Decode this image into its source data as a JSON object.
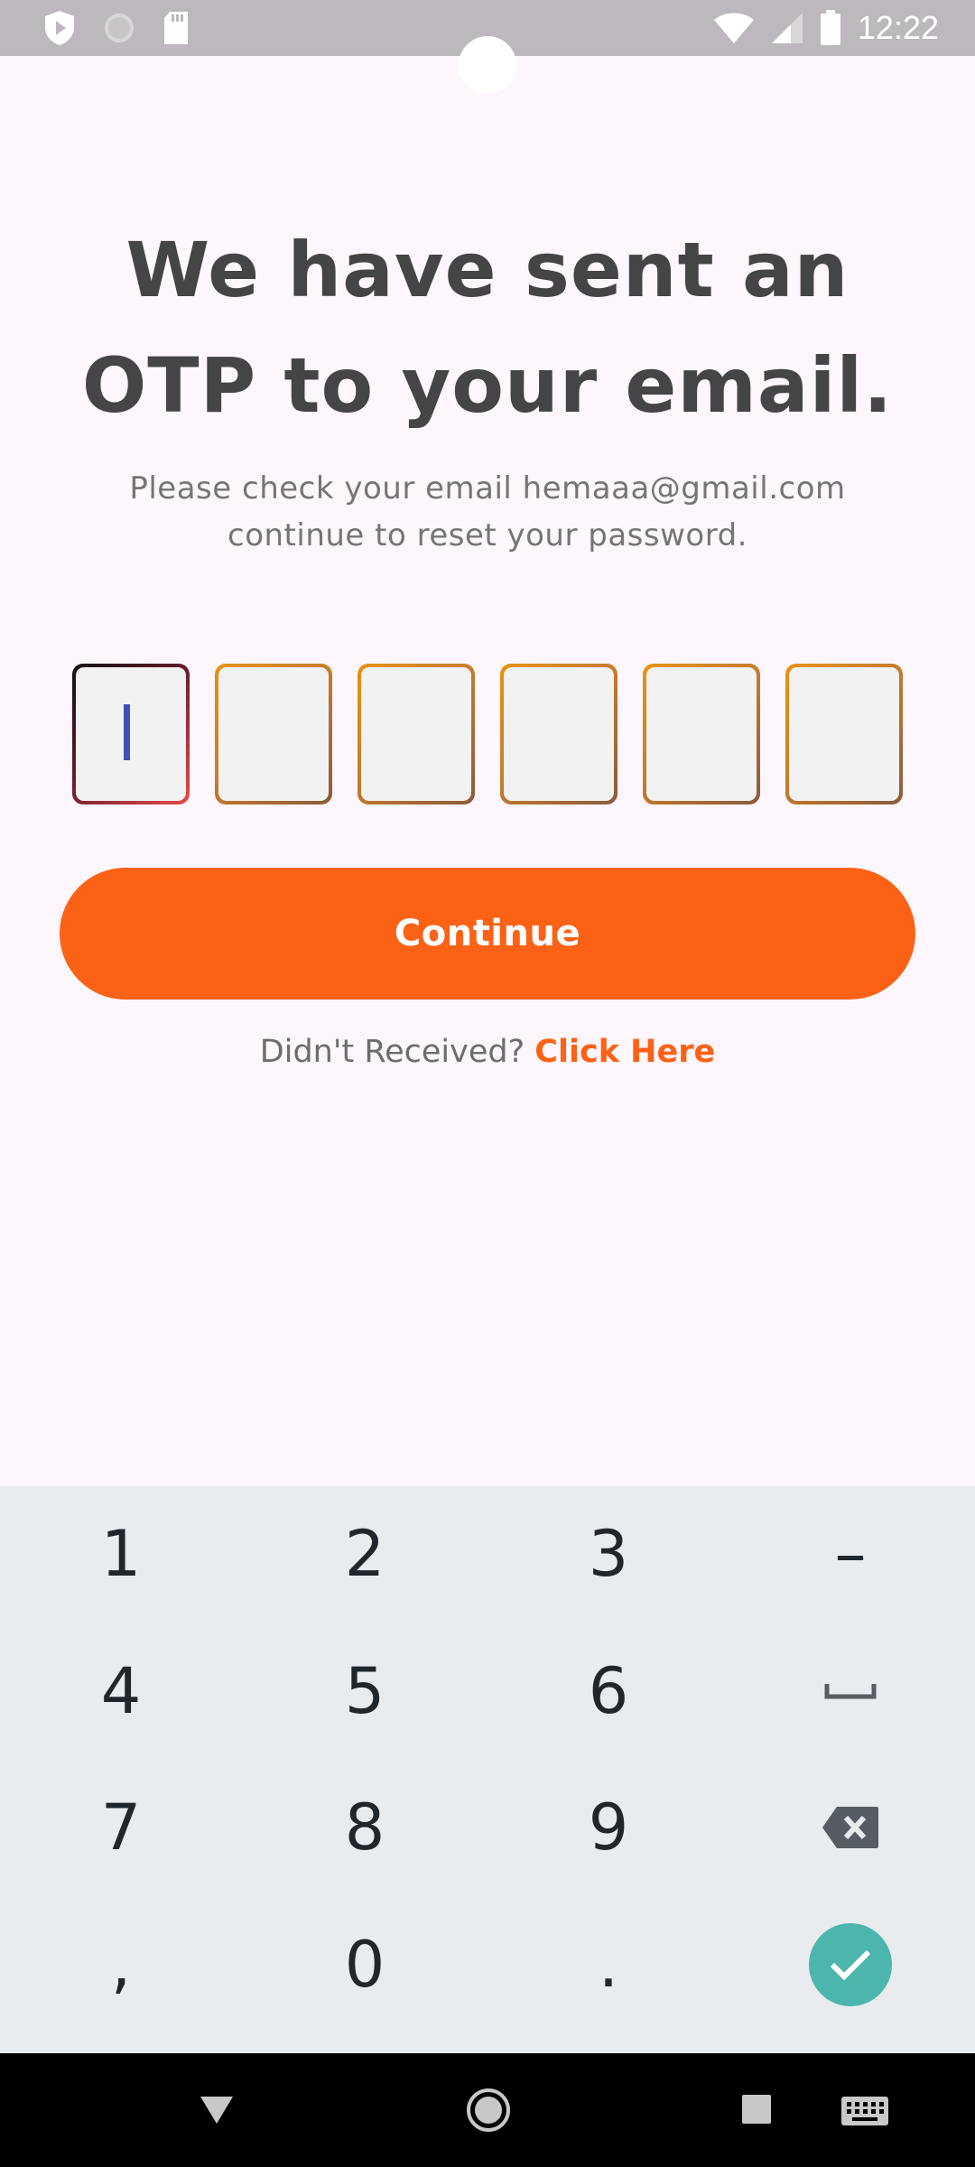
{
  "status_bar": {
    "time": "12:22",
    "left_icons": [
      "shield-play-icon",
      "circle-icon",
      "sd-card-icon"
    ],
    "right_icons": [
      "wifi-icon",
      "signal-icon",
      "battery-icon"
    ]
  },
  "heading": {
    "line1": "We have sent an",
    "line2": "OTP to your email."
  },
  "subtitle": {
    "line1": "Please check your email hemaaa@gmail.com",
    "line2": "continue to reset your password."
  },
  "otp": {
    "length": 6,
    "values": [
      "",
      "",
      "",
      "",
      "",
      ""
    ],
    "active_index": 0
  },
  "continue_label": "Continue",
  "resend": {
    "prompt": "Didn't Received?",
    "link": "Click Here"
  },
  "keyboard": {
    "keys": [
      [
        "1",
        "2",
        "3",
        "–"
      ],
      [
        "4",
        "5",
        "6",
        "␣"
      ],
      [
        "7",
        "8",
        "9",
        "⌫"
      ],
      [
        ",",
        "0",
        ".",
        "✓"
      ]
    ]
  },
  "nav_bar": [
    "back-icon",
    "home-icon",
    "recents-icon",
    "keyboard-icon"
  ],
  "colors": {
    "accent": "#fb6216",
    "background": "#fdf6fc",
    "heading": "#444545",
    "done_key": "#4db6ac"
  }
}
